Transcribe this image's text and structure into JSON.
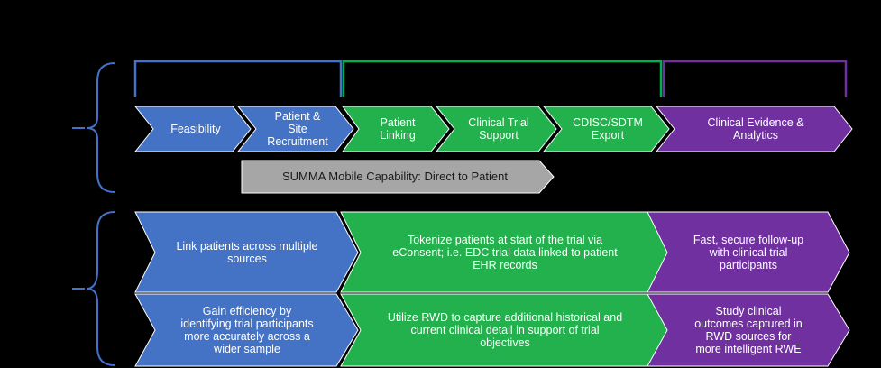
{
  "colors": {
    "blue": "#4472C4",
    "green": "#22B14C",
    "purple": "#7030A0",
    "gray": "#A6A6A6",
    "frame_blue": "#4472C4",
    "frame_green": "#00B050",
    "frame_purple": "#7030A0"
  },
  "process": {
    "steps": [
      {
        "label": "Feasibility",
        "color": "blue"
      },
      {
        "label": "Patient &\nSite\nRecruitment",
        "color": "blue"
      },
      {
        "label": "Patient\nLinking",
        "color": "green"
      },
      {
        "label": "Clinical Trial\nSupport",
        "color": "green"
      },
      {
        "label": "CDISC/SDTM\nExport",
        "color": "green"
      },
      {
        "label": "Clinical Evidence &\nAnalytics",
        "color": "purple"
      }
    ],
    "mobile_bar": "SUMMA Mobile Capability: Direct to Patient"
  },
  "benefits": {
    "row1": {
      "blue": "Link patients across multiple\nsources",
      "green": "Tokenize patients at start of the trial via\neConsent; i.e. EDC trial data linked to patient\nEHR records",
      "purple": "Fast, secure follow-up\nwith clinical trial\nparticipants"
    },
    "row2": {
      "blue": "Gain efficiency by\nidentifying trial participants\nmore accurately across a\nwider sample",
      "green": "Utilize RWD to capture additional historical and\ncurrent clinical detail in support of trial\nobjectives",
      "purple": "Study clinical\noutcomes captured in\nRWD sources for\nmore intelligent RWE"
    }
  }
}
